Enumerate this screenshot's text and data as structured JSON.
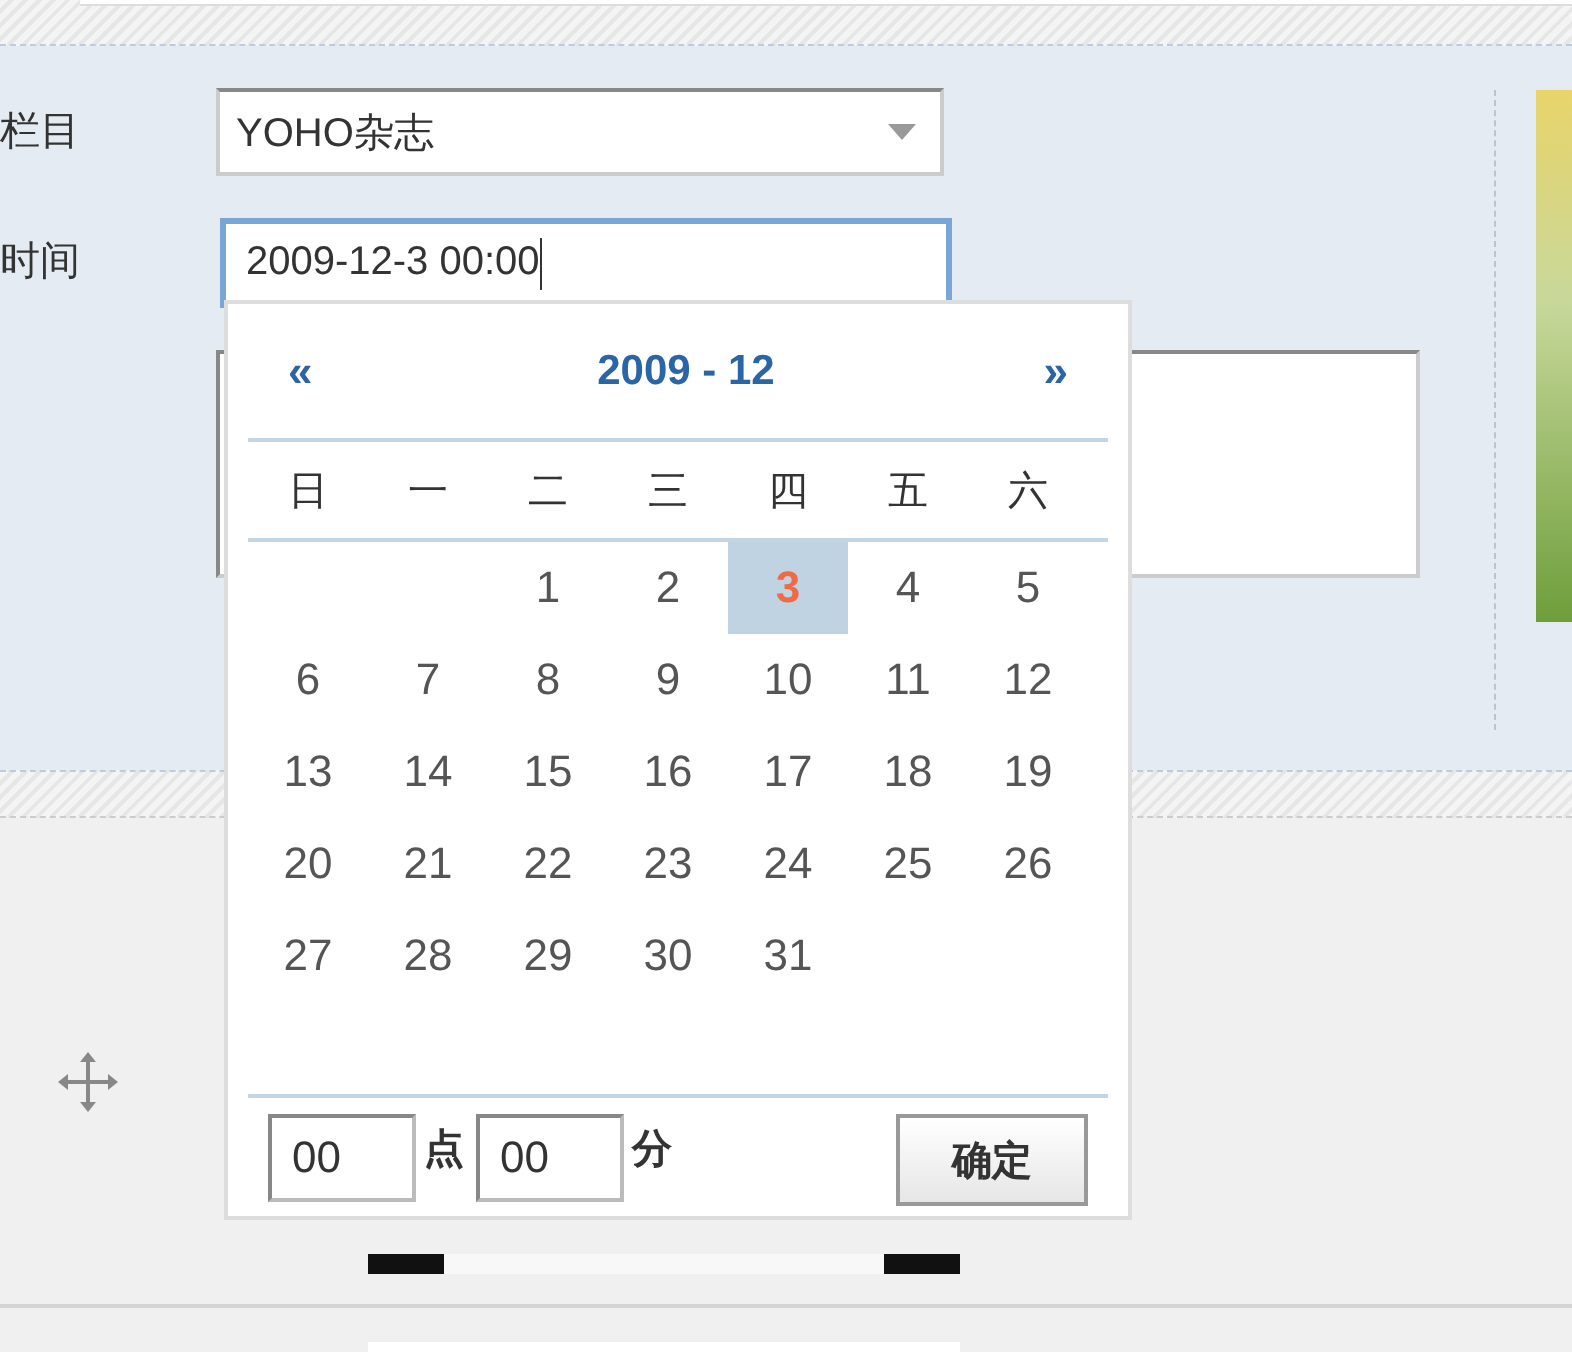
{
  "form": {
    "fields": [
      {
        "kind": "select",
        "label": "栏目",
        "value": "YOHO杂志"
      },
      {
        "kind": "input",
        "label": "时间",
        "value": "2009-12-3 00:00",
        "focused": true
      },
      {
        "kind": "textarea"
      }
    ]
  },
  "calendar": {
    "prev": "«",
    "year": "2009",
    "separator": "-",
    "month": "12",
    "next": "»",
    "weekdays": [
      "日",
      "一",
      "二",
      "三",
      "四",
      "五",
      "六"
    ],
    "weeks": [
      [
        {
          "day": "1",
          "selected": false
        },
        {
          "day": "2",
          "selected": false
        },
        {
          "day": "3",
          "selected": true
        },
        {
          "day": "4",
          "selected": false
        },
        {
          "day": "5",
          "selected": false
        }
      ],
      [
        {
          "day": "6",
          "selected": false
        },
        {
          "day": "7",
          "selected": false
        },
        {
          "day": "8",
          "selected": false
        },
        {
          "day": "9",
          "selected": false
        },
        {
          "day": "10",
          "selected": false
        },
        {
          "day": "11",
          "selected": false
        },
        {
          "day": "12",
          "selected": false
        }
      ],
      [
        {
          "day": "13",
          "selected": false
        },
        {
          "day": "14",
          "selected": false
        },
        {
          "day": "15",
          "selected": false
        },
        {
          "day": "16",
          "selected": false
        },
        {
          "day": "17",
          "selected": false
        },
        {
          "day": "18",
          "selected": false
        },
        {
          "day": "19",
          "selected": false
        }
      ],
      [
        {
          "day": "20",
          "selected": false
        },
        {
          "day": "21",
          "selected": false
        },
        {
          "day": "22",
          "selected": false
        },
        {
          "day": "23",
          "selected": false
        },
        {
          "day": "24",
          "selected": false
        },
        {
          "day": "25",
          "selected": false
        },
        {
          "day": "26",
          "selected": false
        }
      ],
      [
        {
          "day": "27",
          "selected": false
        },
        {
          "day": "28",
          "selected": false
        },
        {
          "day": "29",
          "selected": false
        },
        {
          "day": "30",
          "selected": false
        },
        {
          "day": "31",
          "selected": false
        }
      ]
    ],
    "hour": "00",
    "hour_unit": "点",
    "minute": "00",
    "minute_unit": "分",
    "confirm": "确定"
  }
}
